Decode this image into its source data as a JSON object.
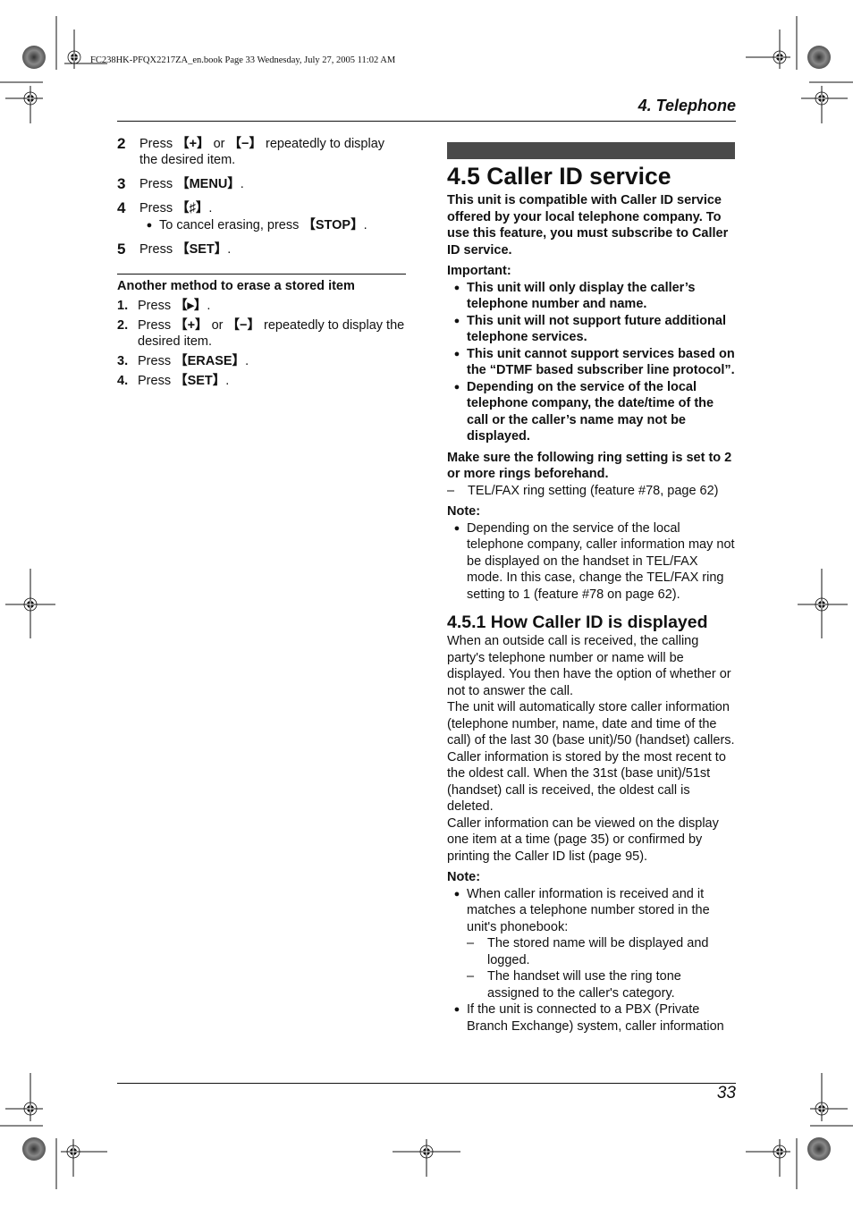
{
  "slug_line": "FC238HK-PFQX2217ZA_en.book  Page 33  Wednesday, July 27, 2005  11:02 AM",
  "header": {
    "chapter_title": "4. Telephone"
  },
  "footer": {
    "page_number": "33"
  },
  "left_column": {
    "steps": [
      {
        "num": "2",
        "pre": "Press ",
        "key1": "【+】",
        "mid": " or ",
        "key2": "【−】",
        "post": " repeatedly to display the desired item."
      },
      {
        "num": "3",
        "pre": "Press ",
        "key1": "【MENU】",
        "post": "."
      },
      {
        "num": "4",
        "pre": "Press ",
        "key1": "【♯】",
        "post": ".",
        "sub_pre": "To cancel erasing, press ",
        "sub_key": "【STOP】",
        "sub_post": "."
      },
      {
        "num": "5",
        "pre": "Press ",
        "key1": "【SET】",
        "post": "."
      }
    ],
    "another_method": {
      "heading": "Another method to erase a stored item",
      "steps": [
        {
          "num": "1.",
          "pre": "Press ",
          "key1": "【▸】",
          "post": "."
        },
        {
          "num": "2.",
          "pre": "Press ",
          "key1": "【+】",
          "mid": " or ",
          "key2": "【−】",
          "post": " repeatedly to display the desired item."
        },
        {
          "num": "3.",
          "pre": "Press ",
          "key1": "【ERASE】",
          "post": "."
        },
        {
          "num": "4.",
          "pre": "Press ",
          "key1": "【SET】",
          "post": "."
        }
      ]
    }
  },
  "right_column": {
    "section_title": "4.5 Caller ID service",
    "intro": "This unit is compatible with Caller ID service offered by your local telephone company. To use this feature, you must subscribe to Caller ID service.",
    "important_label": "Important:",
    "important_items": [
      "This unit will only display the caller’s telephone number and name.",
      "This unit will not support future additional telephone services.",
      "This unit cannot support services based on the “DTMF based subscriber line protocol”.",
      "Depending on the service of the local telephone company, the date/time of the call or the caller’s name may not be displayed."
    ],
    "ring_setting_note": "Make sure the following ring setting is set to 2 or more rings beforehand.",
    "ring_setting_item": "TEL/FAX ring setting (feature #78, page 62)",
    "note1_label": "Note:",
    "note1_items": [
      "Depending on the service of the local telephone company, caller information may not be displayed on the handset in TEL/FAX mode. In this case, change the TEL/FAX ring setting to 1 (feature #78 on page 62)."
    ],
    "subsection_title": "4.5.1 How Caller ID is displayed",
    "paragraphs": [
      "When an outside call is received, the calling party's telephone number or name will be displayed. You then have the option of whether or not to answer the call.",
      "The unit will automatically store caller information (telephone number, name, date and time of the call) of the last 30 (base unit)/50 (handset) callers. Caller information is stored by the most recent to the oldest call. When the 31st (base unit)/51st (handset) call is received, the oldest call is deleted.",
      "Caller information can be viewed on the display one item at a time (page 35) or confirmed by printing the Caller ID list (page 95)."
    ],
    "note2_label": "Note:",
    "note2_item1": "When caller information is received and it matches a telephone number stored in the unit's phonebook:",
    "note2_subitems": [
      "The stored name will be displayed and logged.",
      "The handset will use the ring tone assigned to the caller's category."
    ],
    "note2_item2": "If the unit is connected to a PBX (Private Branch Exchange) system, caller information"
  },
  "icons": {
    "bullet": "●",
    "dash": "–"
  }
}
